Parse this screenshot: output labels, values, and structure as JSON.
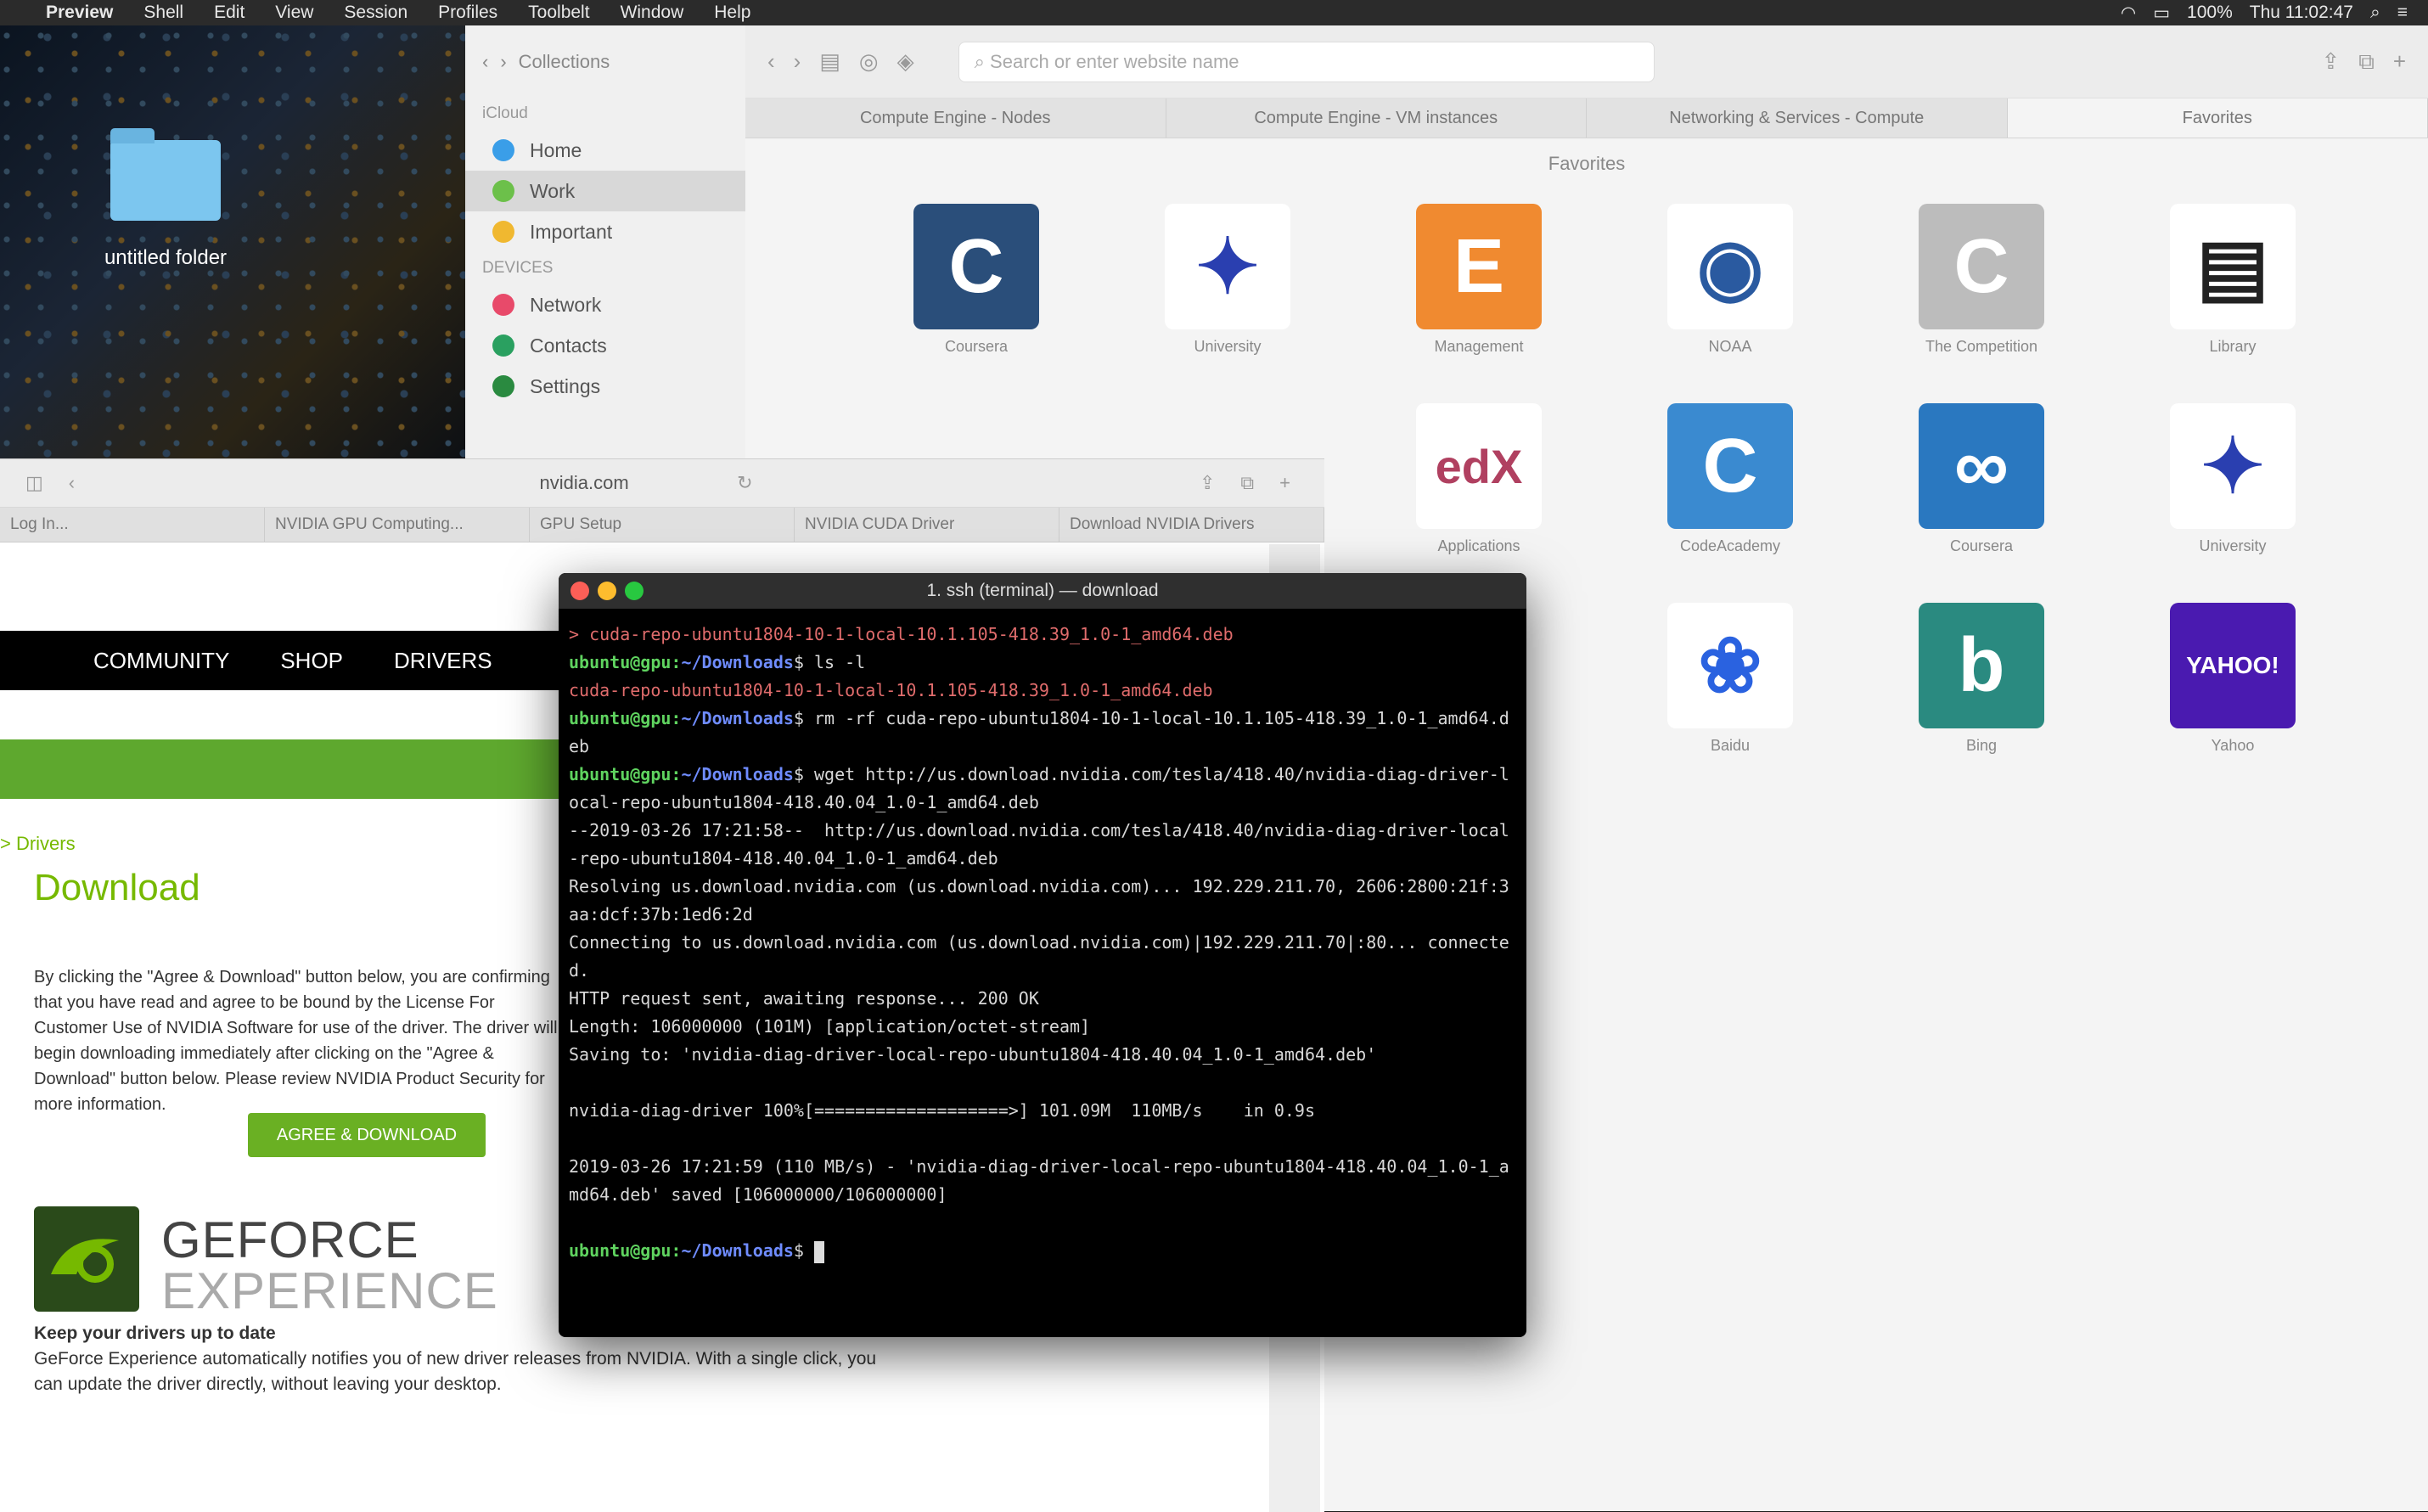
{
  "menubar": {
    "apple": "",
    "items": [
      "Preview",
      "Shell",
      "Edit",
      "View",
      "Session",
      "Profiles",
      "Toolbelt",
      "Window",
      "Help"
    ],
    "right": [
      "100%",
      "Thu 11:02:47"
    ]
  },
  "desktop": {
    "folder_label": "untitled folder"
  },
  "finder": {
    "toolbar_label": "Collections",
    "section_cloud": "iCloud",
    "items": [
      {
        "label": "Home",
        "color": "#3a9ee8"
      },
      {
        "label": "Work",
        "color": "#6cc04a"
      },
      {
        "label": "Important",
        "color": "#f0b830"
      }
    ],
    "section_devices": "DEVICES",
    "device_items": [
      {
        "label": "Network",
        "color": "#e84a6a"
      },
      {
        "label": "Contacts",
        "color": "#2aa060"
      },
      {
        "label": "Settings",
        "color": "#2a8a40"
      }
    ]
  },
  "safari": {
    "address_placeholder": "Search or enter website name",
    "tabs": [
      "Compute Engine - Nodes",
      "Compute Engine - VM instances",
      "Networking & Services - Compute",
      "Favorites"
    ],
    "favorites_title": "Favorites",
    "favorites": [
      {
        "label": "Coursera",
        "letter": "C",
        "color": "#2a4e7a",
        "text": "#fff"
      },
      {
        "label": "University",
        "letter": "✦",
        "color": "#ffffff",
        "text": "#2a3fb0"
      },
      {
        "label": "Management",
        "letter": "E",
        "color": "#f08a30",
        "text": "#fff"
      },
      {
        "label": "NOAA",
        "letter": "◉",
        "color": "#ffffff",
        "text": "#2a5aa0"
      },
      {
        "label": "The Competition",
        "letter": "C",
        "color": "#bcbcbc",
        "text": "#fff"
      },
      {
        "label": "Library",
        "letter": "▤",
        "color": "#ffffff",
        "text": "#222"
      },
      {
        "label": "Applications",
        "letter": "edX",
        "color": "#ffffff",
        "text": "#b04060"
      },
      {
        "label": "CodeAcademy",
        "letter": "C",
        "color": "#3a8ad0",
        "text": "#fff"
      },
      {
        "label": "Coursera",
        "letter": "∞",
        "color": "#2a78c0",
        "text": "#fff"
      },
      {
        "label": "University",
        "letter": "✦",
        "color": "#ffffff",
        "text": "#2a3fb0"
      },
      {
        "label": "Baidu",
        "letter": "❀",
        "color": "#ffffff",
        "text": "#2a62e0"
      },
      {
        "label": "Bing",
        "letter": "b",
        "color": "#2a8a80",
        "text": "#fff"
      },
      {
        "label": "Yahoo",
        "letter": "YAHOO!",
        "color": "#4a1ab0",
        "text": "#fff"
      }
    ]
  },
  "nvidia": {
    "url": "nvidia.com",
    "tabs": [
      "Log In...",
      "NVIDIA GPU Computing...",
      "GPU Setup",
      "NVIDIA CUDA Driver",
      "Download NVIDIA Drivers"
    ],
    "nav": [
      "COMMUNITY",
      "SHOP",
      "DRIVERS"
    ],
    "breadcrumb": "> Drivers",
    "heading": "Download",
    "paragraph": "By clicking the \"Agree & Download\" button below, you are confirming that you have read and agree to be bound by the License For Customer Use of NVIDIA Software for use of the driver. The driver will begin downloading immediately after clicking on the \"Agree & Download\" button below. Please review NVIDIA Product Security for more information.",
    "button": "AGREE & DOWNLOAD",
    "gf_title": "GEFORCE",
    "gf_subtitle": "EXPERIENCE",
    "gf_heading": "Keep your drivers up to date",
    "gf_text": "GeForce Experience automatically notifies you of new driver releases from NVIDIA. With a single click, you can update the driver directly, without leaving your desktop."
  },
  "terminal": {
    "title": "1. ssh (terminal) — download",
    "lines": [
      {
        "type": "red",
        "text": "> cuda-repo-ubuntu1804-10-1-local-10.1.105-418.39_1.0-1_amd64.deb"
      },
      {
        "type": "prompt",
        "user": "ubuntu@gpu:",
        "path": "~/Downloads",
        "cmd": "$ ls -l"
      },
      {
        "type": "red",
        "text": "cuda-repo-ubuntu1804-10-1-local-10.1.105-418.39_1.0-1_amd64.deb"
      },
      {
        "type": "prompt",
        "user": "ubuntu@gpu:",
        "path": "~/Downloads",
        "cmd": "$ rm -rf cuda-repo-ubuntu1804-10-1-local-10.1.105-418.39_1.0-1_amd64.deb"
      },
      {
        "type": "prompt",
        "user": "ubuntu@gpu:",
        "path": "~/Downloads",
        "cmd": "$ wget http://us.download.nvidia.com/tesla/418.40/nvidia-diag-driver-local-repo-ubuntu1804-418.40.04_1.0-1_amd64.deb"
      },
      {
        "type": "plain",
        "text": "--2019-03-26 17:21:58--  http://us.download.nvidia.com/tesla/418.40/nvidia-diag-driver-local-repo-ubuntu1804-418.40.04_1.0-1_amd64.deb"
      },
      {
        "type": "plain",
        "text": "Resolving us.download.nvidia.com (us.download.nvidia.com)... 192.229.211.70, 2606:2800:21f:3aa:dcf:37b:1ed6:2d"
      },
      {
        "type": "plain",
        "text": "Connecting to us.download.nvidia.com (us.download.nvidia.com)|192.229.211.70|:80... connected."
      },
      {
        "type": "plain",
        "text": "HTTP request sent, awaiting response... 200 OK"
      },
      {
        "type": "plain",
        "text": "Length: 106000000 (101M) [application/octet-stream]"
      },
      {
        "type": "plain",
        "text": "Saving to: 'nvidia-diag-driver-local-repo-ubuntu1804-418.40.04_1.0-1_amd64.deb'"
      },
      {
        "type": "plain",
        "text": ""
      },
      {
        "type": "plain",
        "text": "nvidia-diag-driver 100%[===================>] 101.09M  110MB/s    in 0.9s"
      },
      {
        "type": "plain",
        "text": ""
      },
      {
        "type": "plain",
        "text": "2019-03-26 17:21:59 (110 MB/s) - 'nvidia-diag-driver-local-repo-ubuntu1804-418.40.04_1.0-1_amd64.deb' saved [106000000/106000000]"
      },
      {
        "type": "plain",
        "text": ""
      },
      {
        "type": "prompt-cursor",
        "user": "ubuntu@gpu:",
        "path": "~/Downloads",
        "cmd": "$ "
      }
    ]
  }
}
